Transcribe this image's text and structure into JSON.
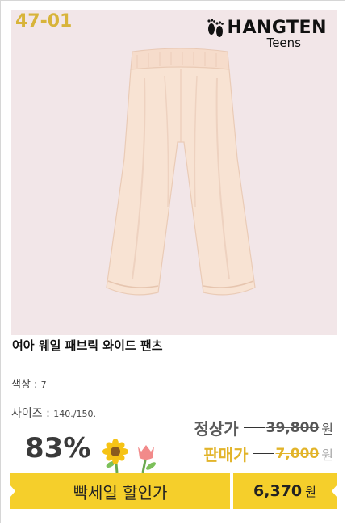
{
  "product": {
    "code": "47-01",
    "brand_name": "HANGTEN",
    "brand_sub": "Teens",
    "title": "여아 웨일 패브릭 와이드 팬츠"
  },
  "options": {
    "color_label": "색상 :",
    "color_value": "7",
    "size_label": "사이즈 :",
    "size_value": "140./150."
  },
  "pricing": {
    "regular_label": "정상가",
    "regular_price": "39,800",
    "sale_label": "판매가",
    "sale_price": "7,000",
    "unit": "원",
    "discount": "83%"
  },
  "promo": {
    "label": "빡세일 할인가",
    "price": "6,370",
    "unit": "원"
  },
  "colors": {
    "photo_bg": "#f2e6e8",
    "accent_yellow": "#f5cf2b",
    "code_gold": "#d8b43a",
    "pants": "#f8e3d3"
  },
  "icons": [
    "footprints-logo-icon",
    "sunflower-icon",
    "tulip-icon"
  ]
}
